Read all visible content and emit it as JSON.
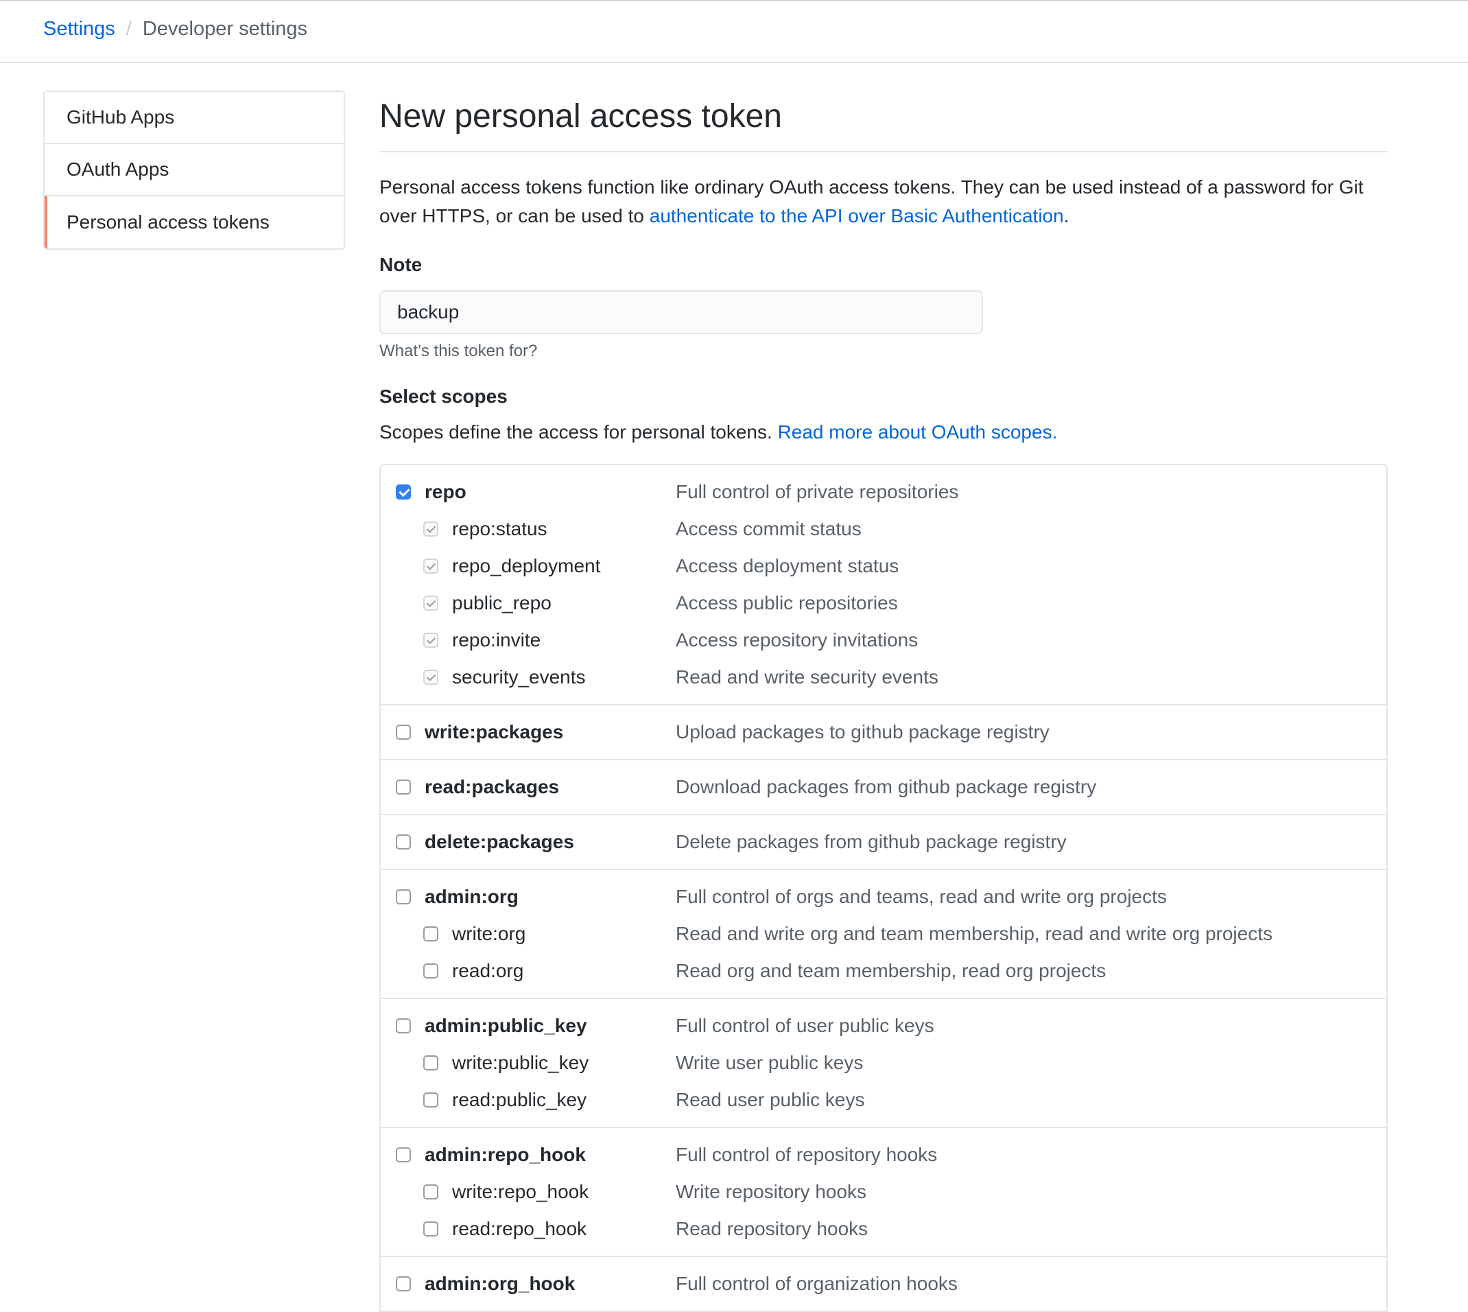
{
  "breadcrumb": {
    "settings": "Settings",
    "separator": "/",
    "current": "Developer settings"
  },
  "sidebar": {
    "items": [
      {
        "label": "GitHub Apps",
        "selected": false
      },
      {
        "label": "OAuth Apps",
        "selected": false
      },
      {
        "label": "Personal access tokens",
        "selected": true
      }
    ],
    "selected_accent": "#f9826c"
  },
  "main": {
    "title": "New personal access token",
    "intro_text": "Personal access tokens function like ordinary OAuth access tokens. They can be used instead of a password for Git over HTTPS, or can be used to ",
    "intro_link": "authenticate to the API over Basic Authentication",
    "intro_end": ".",
    "note_label": "Note",
    "note_value": "backup",
    "note_help": "What’s this token for?",
    "scopes_label": "Select scopes",
    "scopes_text": "Scopes define the access for personal tokens. ",
    "scopes_link": "Read more about OAuth scopes."
  },
  "scopes": [
    {
      "name": "repo",
      "desc": "Full control of private repositories",
      "checked": true,
      "children": [
        {
          "name": "repo:status",
          "desc": "Access commit status",
          "checked": true
        },
        {
          "name": "repo_deployment",
          "desc": "Access deployment status",
          "checked": true
        },
        {
          "name": "public_repo",
          "desc": "Access public repositories",
          "checked": true
        },
        {
          "name": "repo:invite",
          "desc": "Access repository invitations",
          "checked": true
        },
        {
          "name": "security_events",
          "desc": "Read and write security events",
          "checked": true
        }
      ]
    },
    {
      "name": "write:packages",
      "desc": "Upload packages to github package registry",
      "checked": false,
      "children": []
    },
    {
      "name": "read:packages",
      "desc": "Download packages from github package registry",
      "checked": false,
      "children": []
    },
    {
      "name": "delete:packages",
      "desc": "Delete packages from github package registry",
      "checked": false,
      "children": []
    },
    {
      "name": "admin:org",
      "desc": "Full control of orgs and teams, read and write org projects",
      "checked": false,
      "children": [
        {
          "name": "write:org",
          "desc": "Read and write org and team membership, read and write org projects",
          "checked": false
        },
        {
          "name": "read:org",
          "desc": "Read org and team membership, read org projects",
          "checked": false
        }
      ]
    },
    {
      "name": "admin:public_key",
      "desc": "Full control of user public keys",
      "checked": false,
      "children": [
        {
          "name": "write:public_key",
          "desc": "Write user public keys",
          "checked": false
        },
        {
          "name": "read:public_key",
          "desc": "Read user public keys",
          "checked": false
        }
      ]
    },
    {
      "name": "admin:repo_hook",
      "desc": "Full control of repository hooks",
      "checked": false,
      "children": [
        {
          "name": "write:repo_hook",
          "desc": "Write repository hooks",
          "checked": false
        },
        {
          "name": "read:repo_hook",
          "desc": "Read repository hooks",
          "checked": false
        }
      ]
    },
    {
      "name": "admin:org_hook",
      "desc": "Full control of organization hooks",
      "checked": false,
      "children": []
    }
  ],
  "colors": {
    "link": "#0366d6",
    "checkbox_checked": "#2f80ed",
    "border": "#e1e4e8",
    "muted_text": "#586069"
  }
}
